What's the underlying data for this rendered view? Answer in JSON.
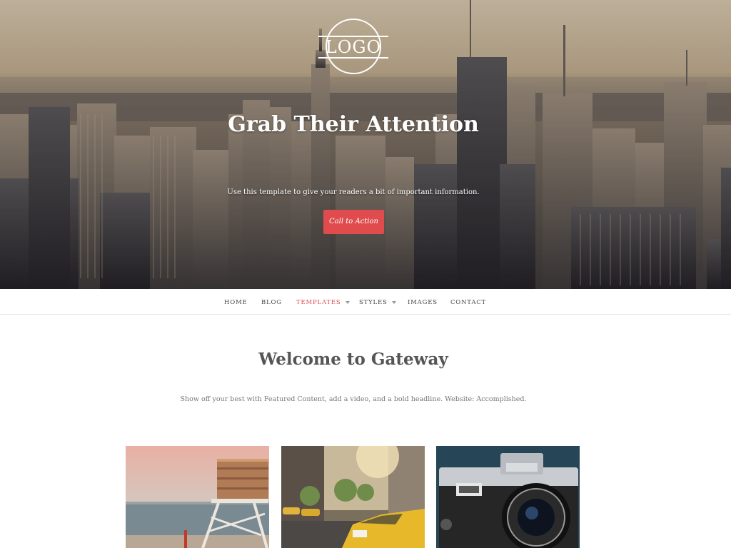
{
  "hero": {
    "logo_text": "LOGO",
    "title": "Grab Their Attention",
    "subtitle": "Use this template to give your readers a bit of important information.",
    "cta_label": "Call to Action"
  },
  "nav": {
    "items": [
      {
        "label": "HOME"
      },
      {
        "label": "BLOG"
      },
      {
        "label": "TEMPLATES",
        "active": true,
        "has_dropdown": true
      },
      {
        "label": "STYLES",
        "has_dropdown": true
      },
      {
        "label": "IMAGES"
      },
      {
        "label": "CONTACT"
      }
    ]
  },
  "main": {
    "title": "Welcome to Gateway",
    "subtitle": "Show off your best with Featured Content, add a video, and a bold headline. Website: Accomplished."
  },
  "cards": [
    {
      "icon": "lifeguard-tower-image"
    },
    {
      "icon": "taxi-street-image"
    },
    {
      "icon": "camera-image"
    }
  ],
  "colors": {
    "accent": "#e04b4e",
    "text": "#555555",
    "nav_border": "#e6e6e6"
  }
}
